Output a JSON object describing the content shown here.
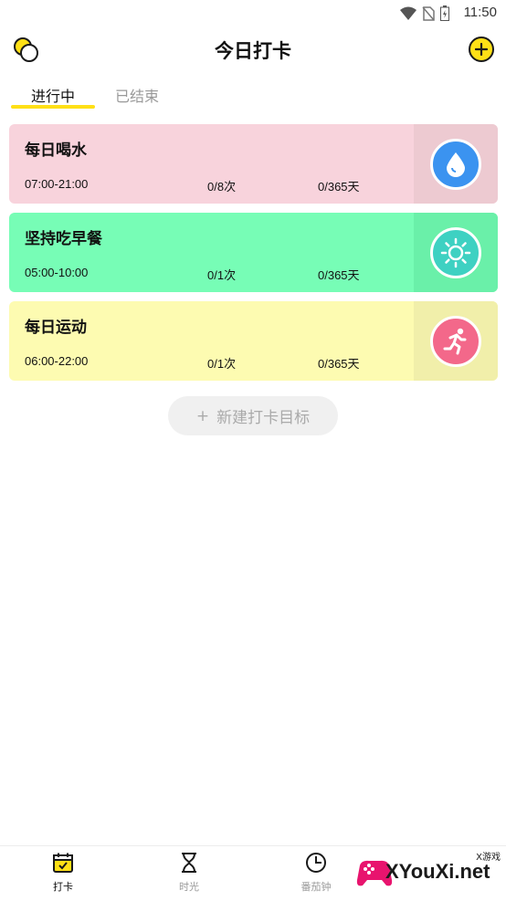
{
  "status_bar": {
    "time": "11:50"
  },
  "header": {
    "title": "今日打卡"
  },
  "tabs": [
    {
      "label": "进行中",
      "active": true
    },
    {
      "label": "已结束",
      "active": false
    }
  ],
  "cards": [
    {
      "title": "每日喝水",
      "time_range": "07:00-21:00",
      "count": "0/8次",
      "days": "0/365天",
      "bg": "#F8D3DC",
      "icon_panel": "#EDCAD1",
      "icon_color": "#3B93F0",
      "icon": "water-drop-icon"
    },
    {
      "title": "坚持吃早餐",
      "time_range": "05:00-10:00",
      "count": "0/1次",
      "days": "0/365天",
      "bg": "#77FDB6",
      "icon_panel": "#6AF0A9",
      "icon_color": "#3ED1C2",
      "icon": "sun-icon"
    },
    {
      "title": "每日运动",
      "time_range": "06:00-22:00",
      "count": "0/1次",
      "days": "0/365天",
      "bg": "#FDFBB1",
      "icon_panel": "#F1EFAA",
      "icon_color": "#F3688A",
      "icon": "running-icon"
    }
  ],
  "new_goal_button": {
    "plus": "+",
    "label": "新建打卡目标"
  },
  "bottom_nav": [
    {
      "label": "打卡",
      "icon": "calendar-check-icon",
      "active": true
    },
    {
      "label": "时光",
      "icon": "hourglass-icon",
      "active": false
    },
    {
      "label": "番茄钟",
      "icon": "clock-icon",
      "active": false
    }
  ],
  "watermark": {
    "text": "XYouXi.net",
    "small": "X游戏"
  },
  "colors": {
    "accent": "#FFE016"
  }
}
